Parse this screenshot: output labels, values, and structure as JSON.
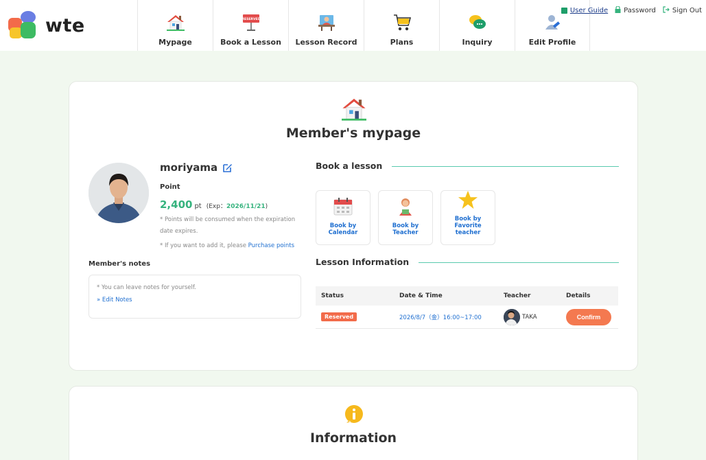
{
  "brand": {
    "name": "wte"
  },
  "nav": [
    {
      "label": "Mypage",
      "icon": "house-icon"
    },
    {
      "label": "Book a Lesson",
      "icon": "reserved-sign-icon"
    },
    {
      "label": "Lesson Record",
      "icon": "teacher-desk-icon"
    },
    {
      "label": "Plans",
      "icon": "shopping-cart-icon"
    },
    {
      "label": "Inquiry",
      "icon": "chat-bubbles-icon"
    },
    {
      "label": "Edit Profile",
      "icon": "user-edit-icon"
    }
  ],
  "utility": {
    "guide": "User Guide",
    "password": "Password",
    "signout": "Sign Out"
  },
  "mypage": {
    "title": "Member's mypage",
    "username": "moriyama",
    "point_label": "Point",
    "points": "2,400",
    "points_unit": "pt",
    "exp_prefix": "(Exp：",
    "exp_date": "2026/11/21",
    "exp_suffix": ")",
    "note1": "* Points will be consumed when the expiration date expires.",
    "note2_prefix": "* If you want to add it, please ",
    "note2_link": "Purchase points",
    "notes_label": "Member's notes",
    "notes_hint": "* You can leave notes for yourself.",
    "notes_edit": "» Edit Notes"
  },
  "book": {
    "title": "Book a lesson",
    "options": [
      {
        "label": "Book by Calendar",
        "icon": "calendar-icon"
      },
      {
        "label": "Book by Teacher",
        "icon": "teacher-icon"
      },
      {
        "label": "Book by Favorite teacher",
        "icon": "star-icon"
      }
    ]
  },
  "lessons": {
    "title": "Lesson Information",
    "headers": [
      "Status",
      "Date & Time",
      "Teacher",
      "Details"
    ],
    "rows": [
      {
        "status": "Reserved",
        "datetime": "2026/8/7（金）16:00~17:00",
        "teacher": "TAKA",
        "action": "Confirm"
      }
    ]
  },
  "info": {
    "title": "Information"
  },
  "colors": {
    "accent_green": "#36b37e",
    "link_blue": "#1f6fd0",
    "reserved_badge": "#f26b4a",
    "confirm_button": "#f47950",
    "page_bg": "#f1f8ef"
  }
}
